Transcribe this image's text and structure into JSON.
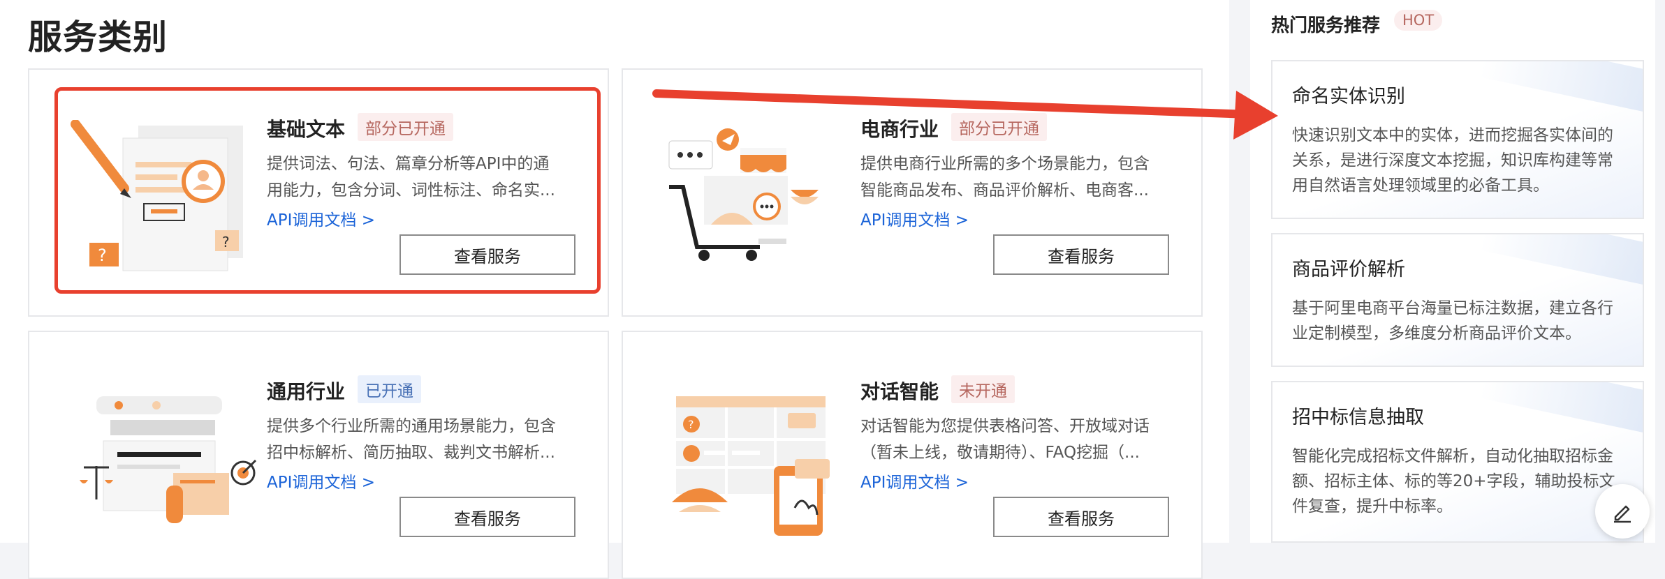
{
  "page": {
    "title": "服务类别"
  },
  "cards": [
    {
      "title": "基础文本",
      "badge": "部分已开通",
      "desc_line1": "提供词法、句法、篇章分析等API中的通",
      "desc_line2": "用能力，包含分词、词性标注、命名实...",
      "link": "API调用文档 >",
      "button": "查看服务"
    },
    {
      "title": "电商行业",
      "badge": "部分已开通",
      "desc_line1": "提供电商行业所需的多个场景能力，包含",
      "desc_line2": "智能商品发布、商品评价解析、电商客...",
      "link": "API调用文档 >",
      "button": "查看服务"
    },
    {
      "title": "通用行业",
      "badge": "已开通",
      "desc_line1": "提供多个行业所需的通用场景能力，包含",
      "desc_line2": "招中标解析、简历抽取、裁判文书解析...",
      "link": "API调用文档 >",
      "button": "查看服务"
    },
    {
      "title": "对话智能",
      "badge": "未开通",
      "desc_line1": "对话智能为您提供表格问答、开放域对话",
      "desc_line2": "（暂未上线，敬请期待）、FAQ挖掘（...",
      "link": "API调用文档 >",
      "button": "查看服务"
    }
  ],
  "sidebar": {
    "title": "热门服务推荐",
    "hot_badge": "HOT",
    "items": [
      {
        "title": "命名实体识别",
        "desc": "快速识别文本中的实体，进而挖掘各实体间的关系，是进行深度文本挖掘，知识库构建等常用自然语言处理领域里的必备工具。"
      },
      {
        "title": "商品评价解析",
        "desc": "基于阿里电商平台海量已标注数据，建立各行业定制模型，多维度分析商品评价文本。"
      },
      {
        "title": "招中标信息抽取",
        "desc": "智能化完成招标文件解析，自动化抽取招标金额、招标主体、标的等20+字段，辅助投标文件复查，提升中标率。"
      }
    ]
  },
  "icons": {
    "fab": "edit-pencil-icon"
  },
  "colors": {
    "accent_red": "#e8402e",
    "link_blue": "#1c64d8",
    "badge_bg": "#fbeeee",
    "badge_text": "#b6675f",
    "orange": "#f08a3c"
  }
}
